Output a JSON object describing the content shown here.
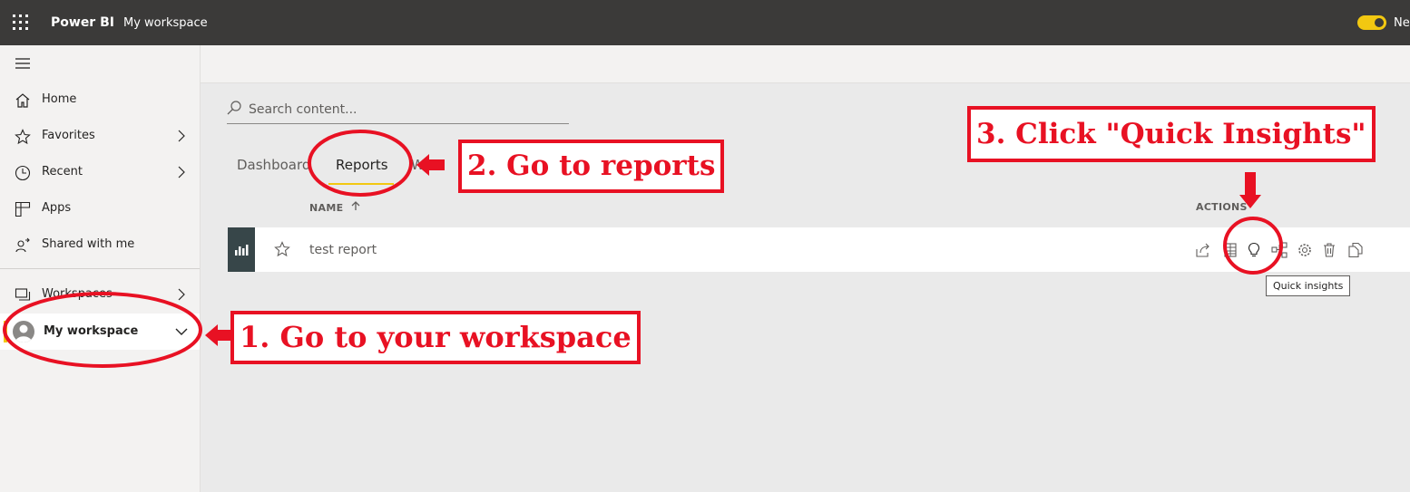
{
  "topbar": {
    "app_name": "Power BI",
    "breadcrumb": "My workspace",
    "toggle_label": "Ne",
    "toggle_color": "#f2c811",
    "icons": [
      "waffle-icon"
    ]
  },
  "sidebar": {
    "items": [
      {
        "label": "Home",
        "icon": "home-icon"
      },
      {
        "label": "Favorites",
        "icon": "star-icon"
      },
      {
        "label": "Recent",
        "icon": "clock-icon"
      },
      {
        "label": "Apps",
        "icon": "apps-icon"
      },
      {
        "label": "Shared with me",
        "icon": "shared-icon"
      },
      {
        "label": "Workspaces",
        "icon": "workspaces-icon"
      }
    ],
    "active_workspace": "My workspace",
    "accent": "#f2c811"
  },
  "content": {
    "search_placeholder": "Search content...",
    "tabs": [
      "Dashboard",
      "Reports",
      "Wo"
    ],
    "active_tab": "Reports",
    "columns": {
      "name": "NAME",
      "actions": "ACTIONS"
    },
    "rows": [
      {
        "name": "test report",
        "icon": "report-icon"
      }
    ],
    "action_icons": [
      "share-icon",
      "table-icon",
      "lightbulb-icon",
      "lineage-icon",
      "settings-icon",
      "delete-icon",
      "copy-icon"
    ],
    "tooltip": "Quick insights"
  },
  "annotations": {
    "step1": "1. Go to your workspace",
    "step2": "2. Go to reports",
    "step3": "3. Click \"Quick Insights\"",
    "color": "#e81123"
  }
}
